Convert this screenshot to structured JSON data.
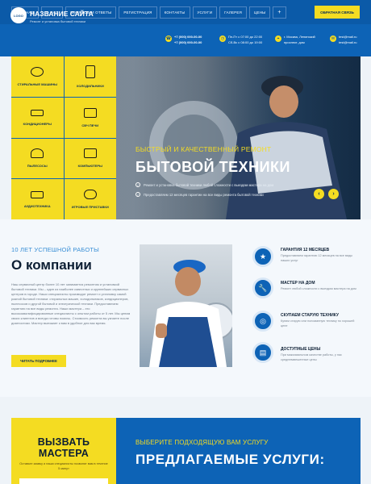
{
  "nav": {
    "items": [
      "ГЛАВНАЯ",
      "О НАС",
      "ВОПРОСЫ И ОТВЕТЫ",
      "РЕГИСТРАЦИЯ",
      "КОНТАКТЫ",
      "УСЛУГИ",
      "ГАЛЕРЕЯ",
      "ЦЕНЫ"
    ],
    "more_icon": "plus-icon",
    "callback": "ОБРАТНАЯ СВЯЗЬ"
  },
  "header": {
    "logo": "LOGO",
    "title": "НАЗВАНИЕ САЙТА",
    "subtitle": "Ремонт и установка бытовой техники",
    "phone1": "+7 (000) 000-00-00",
    "phone2": "+7 (000) 000-00-00",
    "hours1": "Пн-Пт с 07:00 до 22:00",
    "hours2": "Сб-Вс с 08:00 до 19:00",
    "addr1": "г. Москва, Ленинский",
    "addr2": "проспект, дом",
    "mail1": "test@mail.ru",
    "mail2": "test@mail.ru"
  },
  "categories": [
    {
      "label": "СТИРАЛЬНЫЕ МАШИНЫ",
      "icon": "washer-icon"
    },
    {
      "label": "ХОЛОДИЛЬНИКИ",
      "icon": "fridge-icon"
    },
    {
      "label": "КОНДИЦИОНЕРЫ",
      "icon": "aircon-icon"
    },
    {
      "label": "СВЧ ПЕЧИ",
      "icon": "microwave-icon"
    },
    {
      "label": "ПЫЛЕСОСЫ",
      "icon": "vacuum-icon"
    },
    {
      "label": "КОМПЬЮТЕРЫ",
      "icon": "computer-icon"
    },
    {
      "label": "АУДИОТЕХНИКА",
      "icon": "audio-icon"
    },
    {
      "label": "ИГРОВЫЕ ПРИСТАВКИ",
      "icon": "gamepad-icon"
    }
  ],
  "hero": {
    "small": "БЫСТРЫЙ И КАЧЕСТВЕННЫЙ РЕМОНТ",
    "big": "БЫТОВОЙ ТЕХНИКИ",
    "bullet1": "Ремонт и установка бытовой техники любой сложности с выездом мастера на дом",
    "bullet2": "Предоставляем 12 месяцев гарантии на все виды ремонта бытовой техники"
  },
  "about": {
    "small": "10 ЛЕТ УСПЕШНОЙ РАБОТЫ",
    "title": "О компании",
    "text": "Наш сервисный центр более 10 лет занимается ремонтом и установкой бытовой техники. Мы – один из наиболее известных и крупнейших сервисных центров в городе. Наши специалисты производят ремонт и установку самой разной бытовой техники: стиральных машин, холодильников, кондиционеров, пылесосов и другой бытовой и электрической техники. Предоставляем гарантию на все виды ремонта. Наши мастера – это высококвалифицированные специалисты с опытом работы от 5 лет. Мы ценим своих клиентов и всегда готовы помочь. Стоимость ремонта вы узнаете после диагностики. Мастер выезжает к вам в удобное для вас время.",
    "button": "ЧИТАТЬ ПОДРОБНЕЕ"
  },
  "features": [
    {
      "title": "ГАРАНТИЯ 12 МЕСЯЦЕВ",
      "text": "Предоставляем гарантию 12 месяцев на все виды наших услуг",
      "icon": "medal-icon"
    },
    {
      "title": "МАСТЕР НА ДОМ",
      "text": "Ремонт любой сложности с выездом мастера на дом",
      "icon": "wrench-icon"
    },
    {
      "title": "СКУПАЕМ СТАРУЮ ТЕХНИКУ",
      "text": "Купим старую или поломанную технику по хорошей цене",
      "icon": "washer-icon"
    },
    {
      "title": "ДОСТУПНЫЕ ЦЕНЫ",
      "text": "При максимальном качестве работы, у нас средневзвешенные цены",
      "icon": "wallet-icon"
    }
  ],
  "callbox": {
    "title": "ВЫЗВАТЬ МАСТЕРА",
    "text": "Оставьте заявку и наши специалисты позвонят вам в течение 5 минут"
  },
  "services": {
    "small": "ВЫБЕРИТЕ ПОДХОДЯЩУЮ ВАМ УСЛУГУ",
    "title": "ПРЕДЛАГАЕМЫЕ УСЛУГИ:"
  },
  "colors": {
    "primary": "#0d63b6",
    "accent": "#f4dc22",
    "dark": "#0c1e33"
  }
}
